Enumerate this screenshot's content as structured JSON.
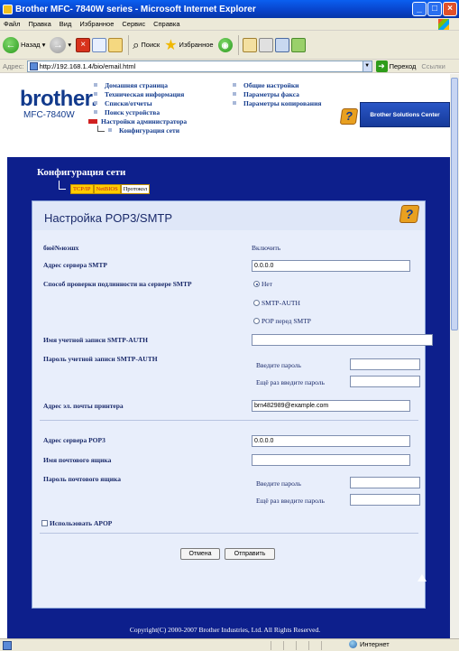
{
  "window": {
    "title": "Brother MFC- 7840W series - Microsoft Internet Explorer"
  },
  "menubar": {
    "items": [
      "Файл",
      "Правка",
      "Вид",
      "Избранное",
      "Сервис",
      "Справка"
    ]
  },
  "toolbar": {
    "back_label": "Назад",
    "search_label": "Поиск",
    "favorites_label": "Избранное"
  },
  "addressbar": {
    "label": "Адрес:",
    "url": "http://192.168.1.4/bio/email.html",
    "go_label": "Переход",
    "links_label": "Ссылки"
  },
  "header": {
    "brand": "brother.",
    "model": "MFC-7840W",
    "nav_left": [
      "Домашняя страница",
      "Техническая информация",
      "Списки/отчеты",
      "Поиск устройства",
      "Настройки администратора",
      "Конфигурация сети"
    ],
    "nav_right": [
      "Общие настройки",
      "Параметры факса",
      "Параметры копирования"
    ],
    "help_icon_text": "?",
    "solutions_center": "Brother Solutions Center"
  },
  "section": {
    "title": "Конфигурация сети",
    "tabs": [
      "TCP/IP",
      "NetBIOS",
      "Протокол"
    ]
  },
  "panel": {
    "title": "Настройка POP3/SMTP",
    "help_icon_text": "?",
    "rows": {
      "status_label": "бюё№юэшх",
      "status_value": "Включить",
      "smtp_server_label": "Адрес сервера SMTP",
      "smtp_server_value": "0.0.0.0",
      "auth_method_label": "Способ проверки подлинности на сервере SMTP",
      "auth_options": [
        "Нет",
        "SMTP-AUTH",
        "POP перед SMTP"
      ],
      "smtp_account_label": "Имя учетной записи SMTP-AUTH",
      "smtp_account_value": "",
      "smtp_password_label": "Пароль учетной записи SMTP-AUTH",
      "enter_password": "Введите пароль",
      "reenter_password": "Ещё раз введите пароль",
      "printer_email_label": "Адрес эл. почты принтера",
      "printer_email_value": "brn482989@example.com",
      "pop3_server_label": "Адрес сервера POP3",
      "pop3_server_value": "0.0.0.0",
      "mailbox_label": "Имя почтового ящика",
      "mailbox_value": "",
      "mailbox_password_label": "Пароль почтового ящика",
      "apop_label": "Использовать APOP"
    },
    "cancel_label": "Отмена",
    "submit_label": "Отправить"
  },
  "footer": {
    "copyright": "Copyright(C) 2000-2007 Brother Industries, Ltd. All Rights Reserved."
  },
  "statusbar": {
    "zone": "Интернет"
  }
}
